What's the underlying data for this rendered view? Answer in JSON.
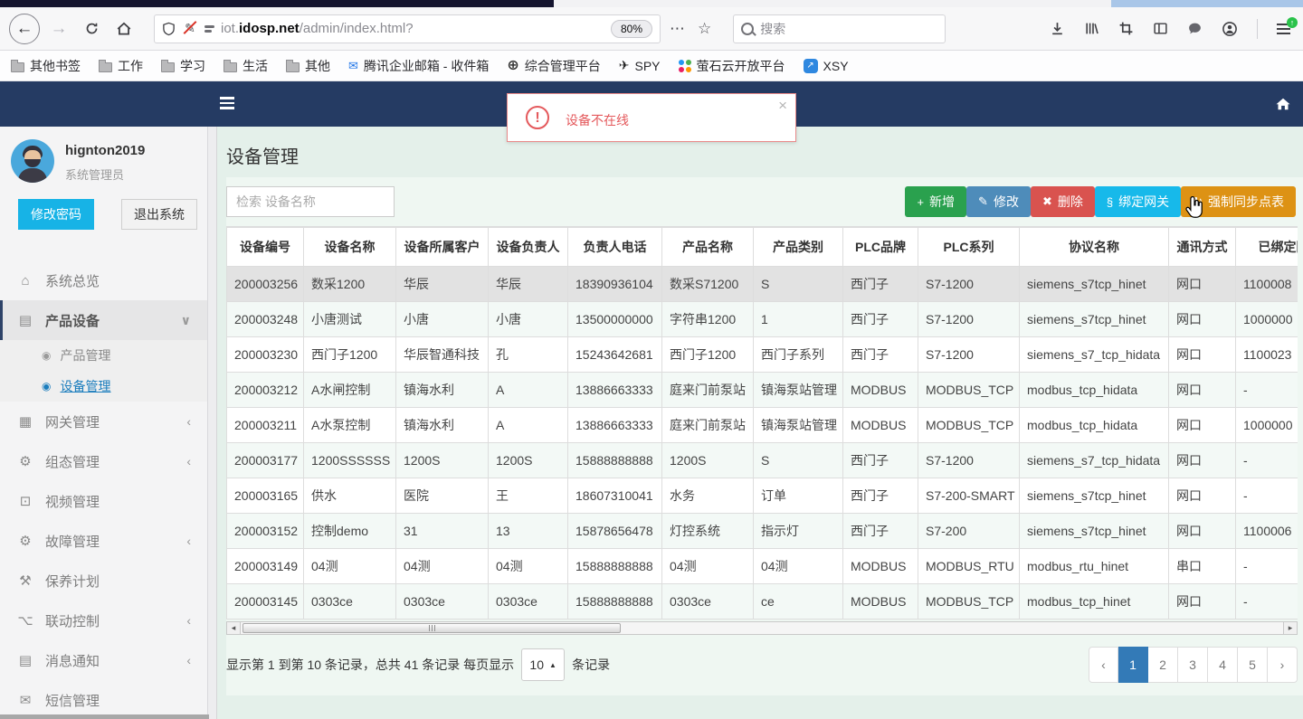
{
  "browser": {
    "url": {
      "prefix": "iot.",
      "domain": "idosp.net",
      "path": "/admin/index.html?"
    },
    "zoom_badge": "80%",
    "search_placeholder": "搜索",
    "bookmarks": [
      {
        "icon": "folder-icon",
        "type": "folder",
        "label": "其他书签"
      },
      {
        "icon": "folder-icon",
        "type": "folder",
        "label": "工作"
      },
      {
        "icon": "folder-icon",
        "type": "folder",
        "label": "学习"
      },
      {
        "icon": "folder-icon",
        "type": "folder",
        "label": "生活"
      },
      {
        "icon": "folder-icon",
        "type": "folder",
        "label": "其他"
      },
      {
        "icon": "tencent-mail-icon",
        "type": "tencent",
        "glyph": "✉",
        "label": "腾讯企业邮箱 - 收件箱"
      },
      {
        "icon": "globe-icon",
        "type": "globe",
        "glyph": "⊕",
        "label": "综合管理平台"
      },
      {
        "icon": "plane-icon",
        "type": "spy",
        "glyph": "✈",
        "label": "SPY"
      },
      {
        "icon": "ezviz-dots-icon",
        "type": "dots",
        "label": "萤石云开放平台"
      },
      {
        "icon": "xsy-icon",
        "type": "xsy",
        "glyph": "↗",
        "label": "XSY"
      }
    ]
  },
  "alert": {
    "message": "设备不在线"
  },
  "sidebar": {
    "user": {
      "name": "hignton2019",
      "role": "系统管理员"
    },
    "change_password_label": "修改密码",
    "logout_label": "退出系统",
    "menu": [
      {
        "name": "system-overview",
        "icon": "home-icon",
        "glyph": "⌂",
        "label": "系统总览"
      },
      {
        "name": "product-device",
        "icon": "book-icon",
        "glyph": "▤",
        "label": "产品设备",
        "chevron": "down",
        "active": true,
        "children": [
          {
            "name": "product-management",
            "icon": "dot-circle-icon",
            "glyph": "◉",
            "label": "产品管理"
          },
          {
            "name": "device-management",
            "icon": "dot-circle-icon",
            "glyph": "◉",
            "label": "设备管理",
            "active": true
          }
        ]
      },
      {
        "name": "gateway-management",
        "icon": "video-icon",
        "glyph": "▦",
        "label": "网关管理",
        "chevron": "left"
      },
      {
        "name": "configuration-management",
        "icon": "gears-icon",
        "glyph": "⚙",
        "label": "组态管理",
        "chevron": "left"
      },
      {
        "name": "video-management",
        "icon": "monitor-icon",
        "glyph": "⊡",
        "label": "视频管理"
      },
      {
        "name": "fault-management",
        "icon": "gears-icon",
        "glyph": "⚙",
        "label": "故障管理",
        "chevron": "left"
      },
      {
        "name": "maintenance-plan",
        "icon": "wrench-icon",
        "glyph": "⚒",
        "label": "保养计划"
      },
      {
        "name": "linkage-control",
        "icon": "sitemap-icon",
        "glyph": "⌥",
        "label": "联动控制",
        "chevron": "left"
      },
      {
        "name": "message-notification",
        "icon": "book-icon",
        "glyph": "▤",
        "label": "消息通知",
        "chevron": "left"
      },
      {
        "name": "sms-management",
        "icon": "envelope-icon",
        "glyph": "✉",
        "label": "短信管理"
      }
    ]
  },
  "main": {
    "page_title": "设备管理",
    "search_placeholder": "检索 设备名称",
    "toolbar": [
      {
        "name": "add-button",
        "icon": "plus-icon",
        "glyph": "+",
        "label": "新增",
        "color": "#2aa14e"
      },
      {
        "name": "edit-button",
        "icon": "pencil-icon",
        "glyph": "✎",
        "label": "修改",
        "color": "#4e8cba"
      },
      {
        "name": "delete-button",
        "icon": "x-icon",
        "glyph": "✖",
        "label": "删除",
        "color": "#d9534f"
      },
      {
        "name": "bind-gateway-button",
        "icon": "link-icon",
        "glyph": "§",
        "label": "绑定网关",
        "color": "#17b9ea"
      },
      {
        "name": "force-sync-button",
        "icon": "refresh-icon",
        "glyph": "↻",
        "label": "强制同步点表",
        "color": "#dd9214"
      }
    ],
    "table": {
      "columns": [
        "设备编号",
        "设备名称",
        "设备所属客户",
        "设备负责人",
        "负责人电话",
        "产品名称",
        "产品类别",
        "PLC品牌",
        "PLC系列",
        "协议名称",
        "通讯方式",
        "已绑定网关"
      ],
      "rows": [
        [
          "200003256",
          "数采1200",
          "华辰",
          "华辰",
          "18390936104",
          "数采S71200",
          "S",
          "西门子",
          "S7-1200",
          "siemens_s7tcp_hinet",
          "网口",
          "1100008"
        ],
        [
          "200003248",
          "小唐测试",
          "小唐",
          "小唐",
          "13500000000",
          "字符串1200",
          "1",
          "西门子",
          "S7-1200",
          "siemens_s7tcp_hinet",
          "网口",
          "1000000"
        ],
        [
          "200003230",
          "西门子1200",
          "华辰智通科技",
          "孔",
          "15243642681",
          "西门子1200",
          "西门子系列",
          "西门子",
          "S7-1200",
          "siemens_s7_tcp_hidata",
          "网口",
          "1100023"
        ],
        [
          "200003212",
          "A水闸控制",
          "镇海水利",
          "A",
          "13886663333",
          "庭来门前泵站",
          "镇海泵站管理",
          "MODBUS",
          "MODBUS_TCP",
          "modbus_tcp_hidata",
          "网口",
          "-"
        ],
        [
          "200003211",
          "A水泵控制",
          "镇海水利",
          "A",
          "13886663333",
          "庭来门前泵站",
          "镇海泵站管理",
          "MODBUS",
          "MODBUS_TCP",
          "modbus_tcp_hidata",
          "网口",
          "1000000"
        ],
        [
          "200003177",
          "1200SSSSSS",
          "1200S",
          "1200S",
          "15888888888",
          "1200S",
          "S",
          "西门子",
          "S7-1200",
          "siemens_s7_tcp_hidata",
          "网口",
          "-"
        ],
        [
          "200003165",
          "供水",
          "医院",
          "王",
          "18607310041",
          "水务",
          "订单",
          "西门子",
          "S7-200-SMART",
          "siemens_s7tcp_hinet",
          "网口",
          "-"
        ],
        [
          "200003152",
          "控制demo",
          "31",
          "13",
          "15878656478",
          "灯控系统",
          "指示灯",
          "西门子",
          "S7-200",
          "siemens_s7tcp_hinet",
          "网口",
          "1100006"
        ],
        [
          "200003149",
          "04测",
          "04测",
          "04测",
          "15888888888",
          "04测",
          "04测",
          "MODBUS",
          "MODBUS_RTU",
          "modbus_rtu_hinet",
          "串口",
          "-"
        ],
        [
          "200003145",
          "0303ce",
          "0303ce",
          "0303ce",
          "15888888888",
          "0303ce",
          "ce",
          "MODBUS",
          "MODBUS_TCP",
          "modbus_tcp_hinet",
          "网口",
          "-"
        ]
      ],
      "selected_row_index": 0
    },
    "footer": {
      "info": "显示第 1 到第 10 条记录，总共 41 条记录 每页显示",
      "per_page": "10",
      "suffix": "条记录",
      "pages": [
        "‹",
        "1",
        "2",
        "3",
        "4",
        "5",
        "›"
      ],
      "active_page": "1"
    }
  },
  "colors": {
    "header_navy": "#253b63",
    "accent_cyan": "#17b3e6",
    "pagination_active": "#337ab7",
    "alert_red": "#e4595c"
  }
}
